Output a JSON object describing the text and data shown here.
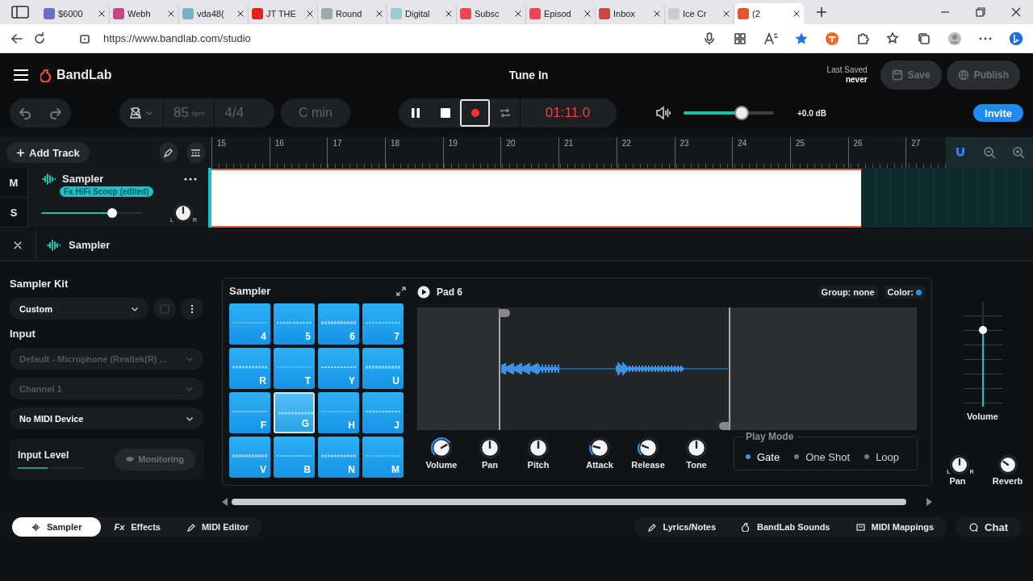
{
  "browser": {
    "tabs": [
      {
        "label": "$6000",
        "selected": false
      },
      {
        "label": "Webh",
        "selected": false
      },
      {
        "label": "vda48(",
        "selected": false
      },
      {
        "label": "JT THE",
        "selected": false
      },
      {
        "label": "Round",
        "selected": false
      },
      {
        "label": "Digital",
        "selected": false
      },
      {
        "label": "Subsc",
        "selected": false
      },
      {
        "label": "Episod",
        "selected": false
      },
      {
        "label": "Inbox",
        "selected": false
      },
      {
        "label": "Ice Cr",
        "selected": false
      },
      {
        "label": "(2",
        "selected": true
      }
    ],
    "url": "https://www.bandlab.com/studio"
  },
  "header": {
    "brand": "BandLab",
    "title": "Tune In",
    "last_saved_label": "Last Saved",
    "last_saved_value": "never",
    "save": "Save",
    "publish": "Publish"
  },
  "toolbar": {
    "bpm": "85",
    "bpm_unit": "bpm",
    "time_signature": "4/4",
    "key": "C min",
    "transport": [
      {
        "kind": "pause",
        "selected": false
      },
      {
        "kind": "stop",
        "selected": false
      },
      {
        "kind": "record",
        "selected": true
      },
      {
        "kind": "loop",
        "selected": false
      }
    ],
    "time": "01:11.0",
    "master_volume": {
      "level": 0.64,
      "reading": "+0.0 dB"
    },
    "invite": "Invite"
  },
  "timeline": {
    "add_track": "Add Track",
    "ruler": [
      "15",
      "16",
      "17",
      "18",
      "19",
      "20",
      "21",
      "22",
      "23",
      "24",
      "25",
      "26",
      "27"
    ]
  },
  "track": {
    "mute": "M",
    "solo": "S",
    "name": "Sampler",
    "effect": "Fx HiFi Scoop (edited)",
    "volume": {
      "level": 0.7
    },
    "pan": {
      "left": "L",
      "right": "R"
    }
  },
  "instrument_panel": {
    "title": "Sampler"
  },
  "left_panel": {
    "kit_heading": "Sampler Kit",
    "kit": "Custom",
    "input_heading": "Input",
    "selects": [
      {
        "value": "Default - Microphone (Realtek(R) ...",
        "disabled": true
      },
      {
        "value": "Channel 1",
        "disabled": true
      },
      {
        "value": "No MIDI Device",
        "disabled": false
      }
    ],
    "input_level": {
      "label": "Input Level",
      "level": 0.45,
      "monitoring": "Monitoring"
    }
  },
  "pads": {
    "title": "Sampler",
    "items": [
      {
        "key": "4",
        "selected": false
      },
      {
        "key": "5",
        "selected": false
      },
      {
        "key": "6",
        "selected": false
      },
      {
        "key": "7",
        "selected": false
      },
      {
        "key": "R",
        "selected": false
      },
      {
        "key": "T",
        "selected": false
      },
      {
        "key": "Y",
        "selected": false
      },
      {
        "key": "U",
        "selected": false
      },
      {
        "key": "F",
        "selected": false
      },
      {
        "key": "G",
        "selected": true
      },
      {
        "key": "H",
        "selected": false
      },
      {
        "key": "J",
        "selected": false
      },
      {
        "key": "V",
        "selected": false
      },
      {
        "key": "B",
        "selected": false
      },
      {
        "key": "N",
        "selected": false
      },
      {
        "key": "M",
        "selected": false
      }
    ]
  },
  "pad_editor": {
    "pad": "Pad 6",
    "group": "Group: none",
    "color_label": "Color:",
    "color": "#2196f3",
    "knobs": [
      {
        "label": "Volume"
      },
      {
        "label": "Pan"
      },
      {
        "label": "Pitch"
      },
      {
        "label": "Attack"
      },
      {
        "label": "Release"
      },
      {
        "label": "Tone"
      }
    ],
    "play_mode": {
      "title": "Play Mode",
      "options": [
        {
          "label": "Gate",
          "selected": true
        },
        {
          "label": "One Shot",
          "selected": false
        },
        {
          "label": "Loop",
          "selected": false
        }
      ]
    }
  },
  "mixer": {
    "volume": {
      "label": "Volume",
      "level": 0.73
    },
    "pan": {
      "label": "Pan",
      "left": "L",
      "right": "R"
    },
    "reverb": {
      "label": "Reverb"
    }
  },
  "bottom_bar": {
    "left": [
      {
        "kind": "sampler",
        "label": "Sampler",
        "selected": true
      },
      {
        "kind": "effects",
        "icon_text": "Fx",
        "label": "Effects",
        "selected": false
      },
      {
        "kind": "midi",
        "label": "MIDI Editor",
        "selected": false
      }
    ],
    "right": [
      {
        "kind": "lyrics",
        "label": "Lyrics/Notes"
      },
      {
        "kind": "sounds",
        "label": "BandLab Sounds"
      },
      {
        "kind": "mappings",
        "label": "MIDI Mappings"
      },
      {
        "kind": "chat",
        "label": "Chat"
      }
    ]
  }
}
